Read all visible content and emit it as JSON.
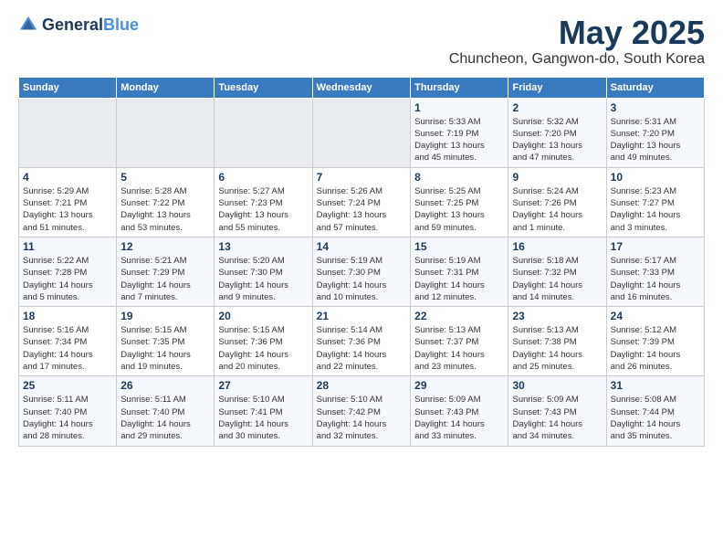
{
  "header": {
    "logo_general": "General",
    "logo_blue": "Blue",
    "title": "May 2025",
    "subtitle": "Chuncheon, Gangwon-do, South Korea"
  },
  "days_of_week": [
    "Sunday",
    "Monday",
    "Tuesday",
    "Wednesday",
    "Thursday",
    "Friday",
    "Saturday"
  ],
  "weeks": [
    [
      {
        "day": "",
        "info": ""
      },
      {
        "day": "",
        "info": ""
      },
      {
        "day": "",
        "info": ""
      },
      {
        "day": "",
        "info": ""
      },
      {
        "day": "1",
        "info": "Sunrise: 5:33 AM\nSunset: 7:19 PM\nDaylight: 13 hours\nand 45 minutes."
      },
      {
        "day": "2",
        "info": "Sunrise: 5:32 AM\nSunset: 7:20 PM\nDaylight: 13 hours\nand 47 minutes."
      },
      {
        "day": "3",
        "info": "Sunrise: 5:31 AM\nSunset: 7:20 PM\nDaylight: 13 hours\nand 49 minutes."
      }
    ],
    [
      {
        "day": "4",
        "info": "Sunrise: 5:29 AM\nSunset: 7:21 PM\nDaylight: 13 hours\nand 51 minutes."
      },
      {
        "day": "5",
        "info": "Sunrise: 5:28 AM\nSunset: 7:22 PM\nDaylight: 13 hours\nand 53 minutes."
      },
      {
        "day": "6",
        "info": "Sunrise: 5:27 AM\nSunset: 7:23 PM\nDaylight: 13 hours\nand 55 minutes."
      },
      {
        "day": "7",
        "info": "Sunrise: 5:26 AM\nSunset: 7:24 PM\nDaylight: 13 hours\nand 57 minutes."
      },
      {
        "day": "8",
        "info": "Sunrise: 5:25 AM\nSunset: 7:25 PM\nDaylight: 13 hours\nand 59 minutes."
      },
      {
        "day": "9",
        "info": "Sunrise: 5:24 AM\nSunset: 7:26 PM\nDaylight: 14 hours\nand 1 minute."
      },
      {
        "day": "10",
        "info": "Sunrise: 5:23 AM\nSunset: 7:27 PM\nDaylight: 14 hours\nand 3 minutes."
      }
    ],
    [
      {
        "day": "11",
        "info": "Sunrise: 5:22 AM\nSunset: 7:28 PM\nDaylight: 14 hours\nand 5 minutes."
      },
      {
        "day": "12",
        "info": "Sunrise: 5:21 AM\nSunset: 7:29 PM\nDaylight: 14 hours\nand 7 minutes."
      },
      {
        "day": "13",
        "info": "Sunrise: 5:20 AM\nSunset: 7:30 PM\nDaylight: 14 hours\nand 9 minutes."
      },
      {
        "day": "14",
        "info": "Sunrise: 5:19 AM\nSunset: 7:30 PM\nDaylight: 14 hours\nand 10 minutes."
      },
      {
        "day": "15",
        "info": "Sunrise: 5:19 AM\nSunset: 7:31 PM\nDaylight: 14 hours\nand 12 minutes."
      },
      {
        "day": "16",
        "info": "Sunrise: 5:18 AM\nSunset: 7:32 PM\nDaylight: 14 hours\nand 14 minutes."
      },
      {
        "day": "17",
        "info": "Sunrise: 5:17 AM\nSunset: 7:33 PM\nDaylight: 14 hours\nand 16 minutes."
      }
    ],
    [
      {
        "day": "18",
        "info": "Sunrise: 5:16 AM\nSunset: 7:34 PM\nDaylight: 14 hours\nand 17 minutes."
      },
      {
        "day": "19",
        "info": "Sunrise: 5:15 AM\nSunset: 7:35 PM\nDaylight: 14 hours\nand 19 minutes."
      },
      {
        "day": "20",
        "info": "Sunrise: 5:15 AM\nSunset: 7:36 PM\nDaylight: 14 hours\nand 20 minutes."
      },
      {
        "day": "21",
        "info": "Sunrise: 5:14 AM\nSunset: 7:36 PM\nDaylight: 14 hours\nand 22 minutes."
      },
      {
        "day": "22",
        "info": "Sunrise: 5:13 AM\nSunset: 7:37 PM\nDaylight: 14 hours\nand 23 minutes."
      },
      {
        "day": "23",
        "info": "Sunrise: 5:13 AM\nSunset: 7:38 PM\nDaylight: 14 hours\nand 25 minutes."
      },
      {
        "day": "24",
        "info": "Sunrise: 5:12 AM\nSunset: 7:39 PM\nDaylight: 14 hours\nand 26 minutes."
      }
    ],
    [
      {
        "day": "25",
        "info": "Sunrise: 5:11 AM\nSunset: 7:40 PM\nDaylight: 14 hours\nand 28 minutes."
      },
      {
        "day": "26",
        "info": "Sunrise: 5:11 AM\nSunset: 7:40 PM\nDaylight: 14 hours\nand 29 minutes."
      },
      {
        "day": "27",
        "info": "Sunrise: 5:10 AM\nSunset: 7:41 PM\nDaylight: 14 hours\nand 30 minutes."
      },
      {
        "day": "28",
        "info": "Sunrise: 5:10 AM\nSunset: 7:42 PM\nDaylight: 14 hours\nand 32 minutes."
      },
      {
        "day": "29",
        "info": "Sunrise: 5:09 AM\nSunset: 7:43 PM\nDaylight: 14 hours\nand 33 minutes."
      },
      {
        "day": "30",
        "info": "Sunrise: 5:09 AM\nSunset: 7:43 PM\nDaylight: 14 hours\nand 34 minutes."
      },
      {
        "day": "31",
        "info": "Sunrise: 5:08 AM\nSunset: 7:44 PM\nDaylight: 14 hours\nand 35 minutes."
      }
    ]
  ]
}
